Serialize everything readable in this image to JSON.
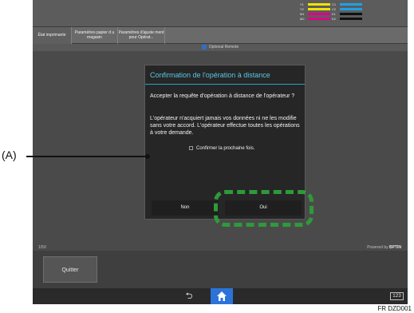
{
  "toner": [
    {
      "label": "Y1",
      "color": "#f2e200",
      "label2": "C1",
      "color2": "#1ea0e6"
    },
    {
      "label": "Y2",
      "color": "#f2e200",
      "label2": "C2",
      "color2": "#1ea0e6"
    },
    {
      "label": "M1",
      "color": "#e0008a",
      "label2": "K1",
      "color2": "#111111"
    },
    {
      "label": "M2",
      "color": "#e0008a",
      "label2": "K2",
      "color2": "#111111"
    }
  ],
  "tabs": [
    {
      "label": "État imprimante"
    },
    {
      "label": "Paramètres papier d u magasin"
    },
    {
      "label": "Paramètres d'ajuste ment pour Opérat..."
    }
  ],
  "subbar": {
    "label": "Optional Remote"
  },
  "page_indicator": "1/50",
  "brand": {
    "prefix": "Powered by",
    "name": "BPTIN"
  },
  "footer": {
    "quit_label": "Quitter"
  },
  "nav": {
    "back_icon": "back-arrow-icon",
    "home_icon": "home-icon",
    "keyboard_label": "123"
  },
  "dialog": {
    "title": "Confirmation de l'opération à distance",
    "question": "Accepter la requête d'opération à distance de l'opérateur ?",
    "body": "L'opérateur n'acquiert jamais vos données ni ne les modifie sans votre accord. L'opérateur effectue toutes les opérations à votre demande.",
    "checkbox_label": "Confirmer la prochaine fois.",
    "no_label": "Non",
    "yes_label": "Oui"
  },
  "callout": {
    "label": "(A)"
  },
  "caption": "FR DZD001",
  "colors": {
    "accent_title": "#5ac8e6",
    "highlight": "#2e9a3a",
    "home_button": "#2b73d9"
  }
}
